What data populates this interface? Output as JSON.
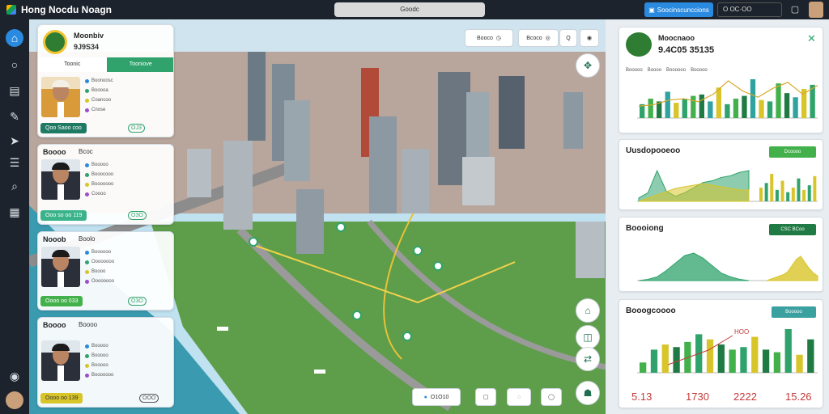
{
  "app": {
    "title": "Hong Nocdu Noagn"
  },
  "search": {
    "text": "Goodc"
  },
  "top": {
    "primary_button": "Soocinscunccions",
    "field": "O OC·OO"
  },
  "cards": [
    {
      "name": "Moonbiv",
      "sub": "9J9S34",
      "tab_left": "Toonic",
      "tab_right": "Tooniove",
      "pill": "Qoo Saoo coo",
      "badge": "OJ3",
      "pill_color": "#1f7a63",
      "photo_bg": "#d99a3a",
      "rows": [
        "Boonoosc",
        "Booooa",
        "Coancoo",
        "Cnose"
      ]
    },
    {
      "name": "Boooo",
      "sub": "Bcoc",
      "pill": "Ooo so oo 119",
      "badge": "O3O",
      "pill_color": "#3bb38a",
      "rows": [
        "Booooo",
        "Booocooo",
        "Booooooo",
        "Coooo"
      ]
    },
    {
      "name": "Nooob",
      "sub": "Boolo",
      "pill": "Oooo oo 033",
      "badge": "O3O",
      "pill_color": "#43b14b",
      "rows": [
        "Boooooo",
        "Oooooooo",
        "Boooo",
        "Oooooooo"
      ]
    },
    {
      "name": "Boooo",
      "sub": "Boooo",
      "pill": "Oooo oo 139",
      "badge": "OOO",
      "pill_color": "#d8c52a",
      "rows": [
        "Booooo",
        "Booooo",
        "Booooo",
        "Booooooo"
      ]
    }
  ],
  "map": {
    "btn_filter": "Booco",
    "btn_layers": "Bcoco",
    "bottom_count": "O1O10",
    "zoom_label": "Q"
  },
  "panels": {
    "overview": {
      "title": "Moocnaoo",
      "value": "9.4C05 35135",
      "legend": [
        "Booooo",
        "Boooo",
        "Boooooo",
        "Booooo"
      ],
      "bars": [
        10,
        14,
        12,
        19,
        11,
        14,
        16,
        17,
        12,
        22,
        10,
        14,
        16,
        28,
        13,
        12,
        25,
        18,
        15,
        21,
        24
      ],
      "line": [
        8,
        9,
        12,
        13,
        11,
        16,
        25,
        18,
        14,
        20,
        24,
        16,
        22
      ]
    },
    "usage": {
      "title": "Uusdopooeoo",
      "btn": "Dcoooo",
      "area_a": [
        2,
        5,
        18,
        6,
        3,
        5,
        8,
        11,
        12,
        14,
        15,
        17,
        18
      ],
      "area_b": [
        0,
        2,
        4,
        6,
        8,
        9,
        10,
        11,
        10,
        9,
        8,
        7,
        7
      ],
      "bars": [
        6,
        8,
        12,
        5,
        9,
        4,
        6,
        10,
        5,
        7,
        11
      ]
    },
    "density": {
      "title": "Boooiong",
      "btn": "CSC BCoo",
      "peak_a": [
        0,
        1,
        3,
        8,
        14,
        20,
        22,
        18,
        12,
        6,
        3,
        1,
        0
      ],
      "peak_b": [
        0,
        1,
        2,
        3,
        4,
        6,
        10,
        14,
        16,
        12,
        8,
        5,
        3
      ]
    },
    "trend": {
      "title": "Booogcoooo",
      "btn": "Booooo",
      "bars": [
        4,
        9,
        11,
        10,
        12,
        15,
        13,
        11,
        9,
        10,
        14,
        9,
        8,
        17,
        7,
        13
      ],
      "annotation": "HOO",
      "values": [
        "5.13",
        "1730",
        "2222",
        "15.26"
      ]
    }
  }
}
